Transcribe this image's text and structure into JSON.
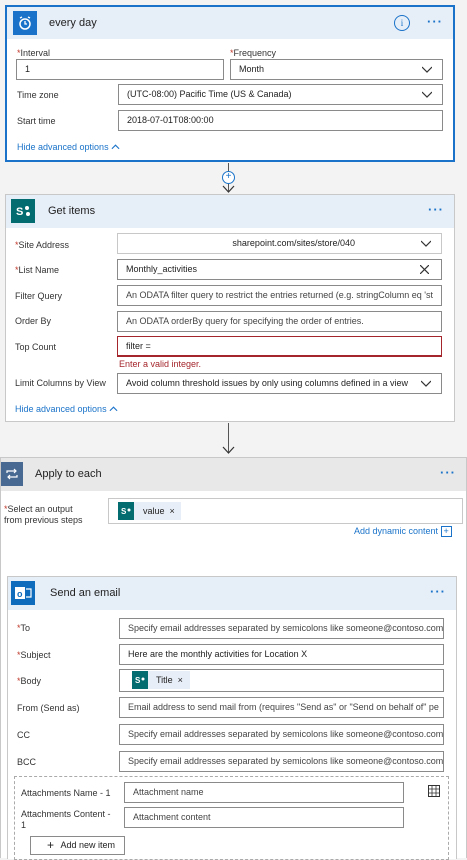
{
  "recurrence": {
    "title": "every day",
    "interval_label": "Interval",
    "interval_value": "1",
    "frequency_label": "Frequency",
    "frequency_value": "Month",
    "timezone_label": "Time zone",
    "timezone_value": "(UTC-08:00) Pacific Time (US & Canada)",
    "starttime_label": "Start time",
    "starttime_value": "2018-07-01T08:00:00",
    "hide_advanced": "Hide advanced options",
    "info_icon": "info-icon",
    "more_icon": "more-icon",
    "icon": "alarm-clock-icon"
  },
  "connector_add": "+",
  "get_items": {
    "title": "Get items",
    "icon": "sharepoint-icon",
    "site_label": "Site Address",
    "site_value": "sharepoint.com/sites/store/040",
    "list_label": "List Name",
    "list_value": "Monthly_activities",
    "filter_label": "Filter Query",
    "filter_placeholder": "An ODATA filter query to restrict the entries returned (e.g. stringColumn eq 'st",
    "order_label": "Order By",
    "order_placeholder": "An ODATA orderBy query for specifying the order of entries.",
    "top_label": "Top Count",
    "top_value": "filter =",
    "top_error": "Enter a valid integer.",
    "limit_label": "Limit Columns by View",
    "limit_value": "Avoid column threshold issues by only using columns defined in a view",
    "hide_advanced": "Hide advanced options"
  },
  "apply_each": {
    "title": "Apply to each",
    "select_label_1": "Select an output",
    "select_label_2": "from previous steps",
    "token_label": "value",
    "add_dynamic": "Add dynamic content",
    "add_dynamic_icon": "+"
  },
  "send_email": {
    "title": "Send an email",
    "icon": "outlook-icon",
    "to_label": "To",
    "to_placeholder": "Specify email addresses separated by semicolons like someone@contoso.com",
    "subject_label": "Subject",
    "subject_value": "Here are the monthly activities for Location X",
    "body_label": "Body",
    "body_token": "Title",
    "from_label": "From (Send as)",
    "from_placeholder": "Email address to send mail from (requires \"Send as\" or \"Send on behalf of\" pe",
    "cc_label": "CC",
    "cc_placeholder": "Specify email addresses separated by semicolons like someone@contoso.com",
    "bcc_label": "BCC",
    "bcc_placeholder": "Specify email addresses separated by semicolons like someone@contoso.com",
    "att_name_label": "Attachments Name - 1",
    "att_name_placeholder": "Attachment name",
    "att_content_label_1": "Attachments Content -",
    "att_content_label_2": "1",
    "att_content_placeholder": "Attachment content",
    "add_item": "Add new item"
  },
  "colors": {
    "accent": "#1a73c9",
    "header_bg": "#e6eef8",
    "required": "#c0392b",
    "sharepoint": "#036c70",
    "outlook": "#0f6cbd"
  }
}
